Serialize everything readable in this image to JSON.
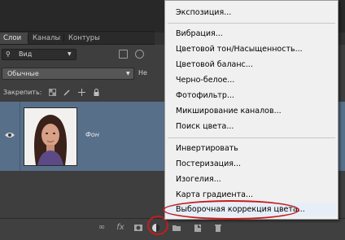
{
  "layers_panel": {
    "tabs": [
      "Слои",
      "Каналы",
      "Контуры"
    ],
    "filter_kind": "Вид",
    "blend_mode": "Обычные",
    "opacity_partial": "Не",
    "lock_label": "Закрепить:",
    "layer": {
      "name": "Фон",
      "visible": true
    }
  },
  "bottom_bar": {
    "icons": [
      "link-icon",
      "fx-icon",
      "mask-icon",
      "adjustment-icon",
      "group-icon",
      "new-layer-icon",
      "trash-icon"
    ],
    "fx_label": "fx"
  },
  "adjustment_menu": {
    "group1": [
      "Экспозиция..."
    ],
    "group2": [
      "Вибрация...",
      "Цветовой тон/Насыщенность...",
      "Цветовой баланс...",
      "Черно-белое...",
      "Фотофильтр...",
      "Микширование каналов...",
      "Поиск цвета..."
    ],
    "group3": [
      "Инвертировать",
      "Постеризация...",
      "Изогелия...",
      "Карта градиента..."
    ],
    "selected": "Выборочная коррекция цвета...",
    "highlight_color": "#c41d1d"
  },
  "colors": {
    "panel_bg": "#3e3e3e",
    "layer_selected": "#586f8a",
    "menu_bg": "#f0f0f0",
    "annotation_red": "#c41d1d"
  }
}
